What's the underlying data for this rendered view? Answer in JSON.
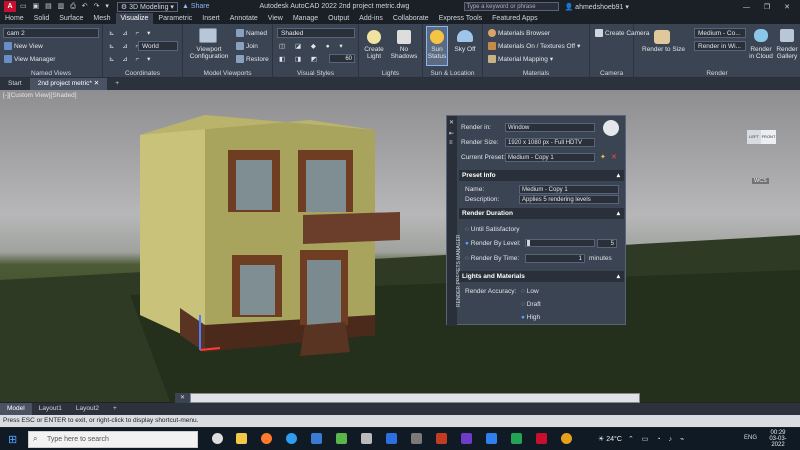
{
  "titlebar": {
    "app_menu": "A",
    "workspace": "3D Modeling",
    "share": "Share",
    "title": "Autodesk AutoCAD 2022   2nd project metric.dwg",
    "search_placeholder": "Type a keyword or phrase",
    "user": "ahmedshoeb91"
  },
  "ribbon_tabs": [
    "Home",
    "Solid",
    "Surface",
    "Mesh",
    "Visualize",
    "Parametric",
    "Insert",
    "Annotate",
    "View",
    "Manage",
    "Output",
    "Add-ins",
    "Collaborate",
    "Express Tools",
    "Featured Apps"
  ],
  "active_tab": "Visualize",
  "ribbon": {
    "named_views": {
      "title": "Named Views",
      "dropdown": "cam 2",
      "new_view": "New View",
      "view_manager": "View Manager"
    },
    "coordinates": {
      "title": "Coordinates",
      "ucs": "World"
    },
    "model_viewports": {
      "title": "Model Viewports",
      "config": "Viewport Configuration",
      "named": "Named",
      "join": "Join",
      "restore": "Restore"
    },
    "visual_styles": {
      "title": "Visual Styles",
      "style": "Shaded",
      "value": "60"
    },
    "lights": {
      "title": "Lights",
      "create_light": "Create Light",
      "no_shadows": "No Shadows"
    },
    "sun_location": {
      "title": "Sun & Location",
      "sun_status": "Sun Status",
      "sky_off": "Sky Off"
    },
    "materials": {
      "title": "Materials",
      "browser": "Materials Browser",
      "textures": "Materials On / Textures Off",
      "mapping": "Material Mapping"
    },
    "camera": {
      "title": "Camera",
      "create_camera": "Create Camera"
    },
    "render": {
      "title": "Render",
      "render_to_size": "Render to Size",
      "preset": "Medium - Co...",
      "render_in": "Render in Wi...",
      "render_cloud": "Render in Cloud",
      "render_gallery": "Render Gallery"
    }
  },
  "doc_tabs": [
    "Start",
    "2nd project metric*"
  ],
  "viewport": {
    "label": "[-][Custom View][Shaded]",
    "viewcube_left": "LEFT",
    "viewcube_front": "FRONT",
    "wcs": "WCS"
  },
  "rpm": {
    "side_title": "RENDER PRESETS MANAGER",
    "render_in_label": "Render in:",
    "render_in_value": "Window",
    "render_size_label": "Render Size:",
    "render_size_value": "1920 x 1080 px - Full HDTV",
    "current_preset_label": "Current Preset:",
    "current_preset_value": "Medium - Copy 1",
    "preset_info": "Preset Info",
    "name_label": "Name:",
    "name_value": "Medium - Copy 1",
    "desc_label": "Description:",
    "desc_value": "Applies 5 rendering levels",
    "render_duration": "Render Duration",
    "until_satisfactory": "Until Satisfactory",
    "render_by_level": "Render By Level:",
    "level_value": "5",
    "render_by_time": "Render By Time:",
    "time_value": "1",
    "minutes": "minutes",
    "lights_materials": "Lights and Materials",
    "render_accuracy": "Render Accuracy:",
    "low": "Low",
    "draft": "Draft",
    "high": "High"
  },
  "layout_tabs": [
    "Model",
    "Layout1",
    "Layout2"
  ],
  "status_text": "Press ESC or ENTER to exit, or right-click to display shortcut-menu.",
  "taskbar": {
    "search_placeholder": "Type here to search",
    "temp": "24°C",
    "lang": "ENG",
    "time": "00:29",
    "date": "03-03-2022"
  }
}
